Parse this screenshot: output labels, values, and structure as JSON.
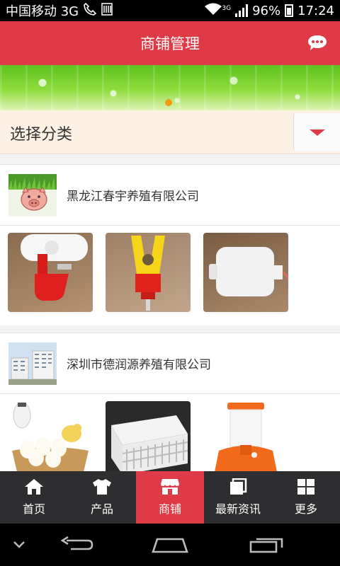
{
  "status_bar": {
    "carrier": "中国移动 3G",
    "network_label": "3G",
    "battery": "96%",
    "time": "17:24"
  },
  "header": {
    "title": "商铺管理",
    "chat_icon": "chat-bubble-icon"
  },
  "banner": {
    "slides": 1,
    "active_index": 0
  },
  "category_select": {
    "label": "选择分类",
    "icon": "chevron-down-icon"
  },
  "shops": [
    {
      "name": "黑龙江春宇养殖有限公司",
      "products": [
        "poultry-drinker",
        "nipple-drinker",
        "plastic-bottle"
      ]
    },
    {
      "name": "深圳市德润源养殖有限公司",
      "products": [
        "egg-basket",
        "plastic-crate",
        "water-dispenser"
      ]
    }
  ],
  "bottom_tabs": [
    {
      "label": "首页",
      "icon": "home-icon",
      "active": false
    },
    {
      "label": "产品",
      "icon": "shirt-icon",
      "active": false
    },
    {
      "label": "商铺",
      "icon": "store-icon",
      "active": true
    },
    {
      "label": "最新资讯",
      "icon": "news-icon",
      "active": false
    },
    {
      "label": "更多",
      "icon": "grid-icon",
      "active": false
    }
  ],
  "colors": {
    "accent": "#de3b46",
    "tab_bar": "#2e2e31",
    "category_bg": "#fdf1e4",
    "dot": "#f39c12"
  }
}
